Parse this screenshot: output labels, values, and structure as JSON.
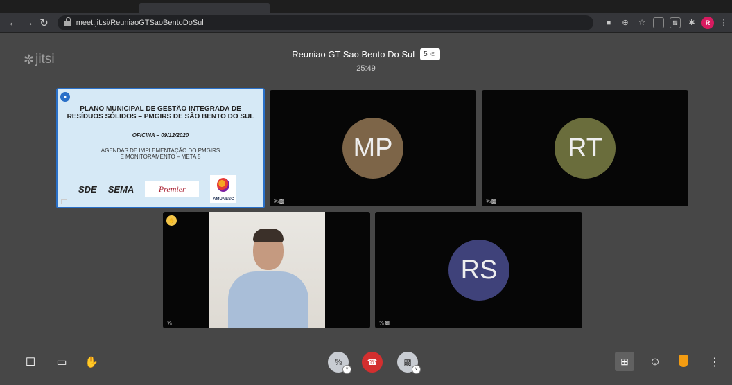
{
  "browser": {
    "url": "meet.jit.si/ReuniaoGTSaoBentoDoSul",
    "profile_initial": "R"
  },
  "app": {
    "logo_text": "jitsi",
    "meeting_title": "Reuniao GT Sao Bento Do Sul",
    "participant_count": "5",
    "timer": "25:49"
  },
  "participants": [
    {
      "initials": "MP",
      "color": "#7d6548"
    },
    {
      "initials": "RT",
      "color": "#6a6d3c"
    },
    {
      "initials": "RS",
      "color": "#3f427a"
    }
  ],
  "slide": {
    "title_line1": "PLANO MUNICIPAL DE GESTÃO INTEGRADA DE",
    "title_line2": "RESÍDUOS SÓLIDOS – PMGIRS DE SÃO BENTO DO SUL",
    "oficina": "OFICINA – 09/12/2020",
    "agenda_line1": "AGENDAS DE IMPLEMENTAÇÃO DO PMGIRS",
    "agenda_line2": "E MONITORAMENTO – META 5",
    "logo_sde": "SDE",
    "logo_sema": "SEMA",
    "logo_premier": "Premier",
    "logo_amunesc": "AMUNESC"
  },
  "colors": {
    "background": "#474747",
    "active_border": "#2a70c8",
    "hangup": "#d32f2f",
    "security": "#f39c12"
  }
}
